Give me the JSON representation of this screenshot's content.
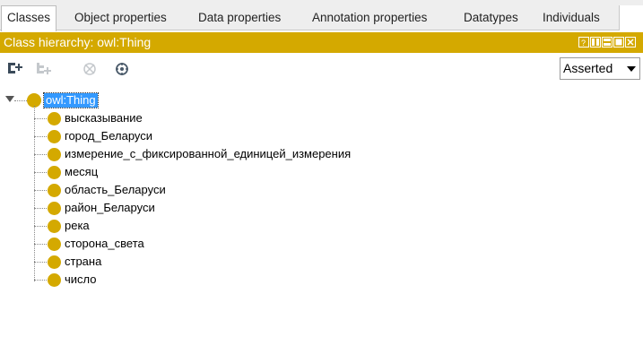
{
  "tabs": [
    {
      "label": "Classes",
      "active": true
    },
    {
      "label": "Object properties",
      "active": false
    },
    {
      "label": "Data properties",
      "active": false
    },
    {
      "label": "Annotation properties",
      "active": false
    },
    {
      "label": "Datatypes",
      "active": false
    },
    {
      "label": "Individuals",
      "active": false
    }
  ],
  "view": {
    "title": "Class hierarchy: owl:Thing",
    "header_color": "#d4a900",
    "window_buttons": [
      "help-icon",
      "restore-icon",
      "minimize-icon",
      "maximize-icon",
      "close-icon"
    ]
  },
  "toolbar": {
    "buttons": [
      "add-subclass-icon",
      "add-sibling-class-icon",
      "delete-class-icon",
      "find-usage-icon"
    ],
    "hierarchy_mode": "Asserted"
  },
  "tree": {
    "root": "owl:Thing",
    "children": [
      "высказывание",
      "город_Беларуси",
      "измерение_с_фиксированной_единицей_измерения",
      "месяц",
      "область_Беларуси",
      "район_Беларуси",
      "река",
      "сторона_света",
      "страна",
      "число"
    ],
    "class_color": "#d4a900"
  }
}
